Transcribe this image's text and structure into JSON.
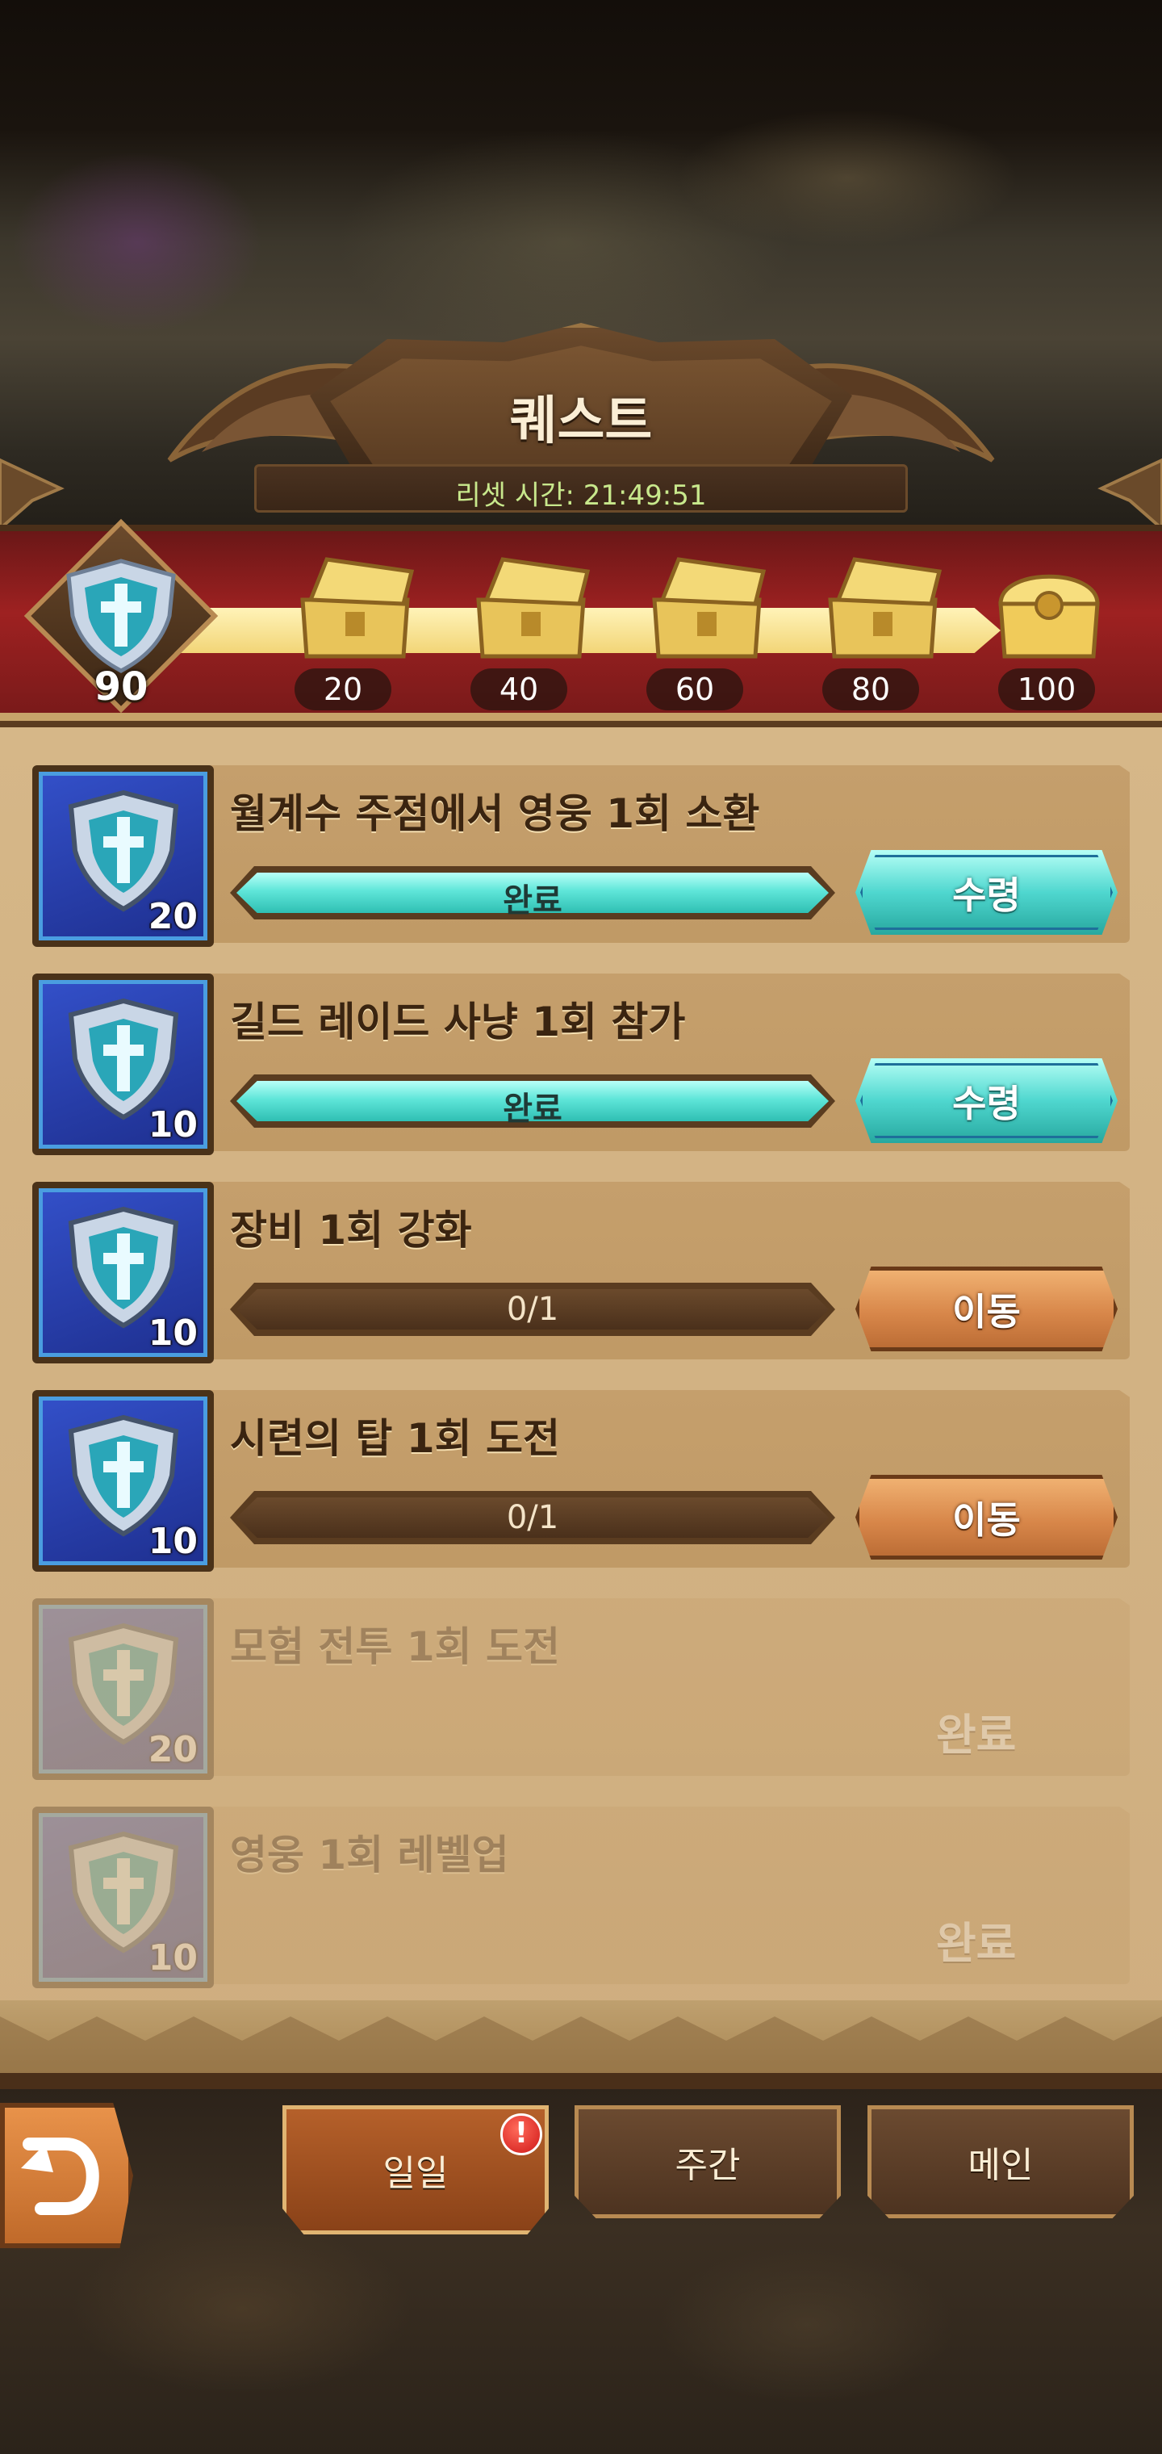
{
  "header": {
    "title": "퀘스트",
    "reset_label": "리셋 시간:",
    "reset_time": "21:49:51"
  },
  "progress": {
    "current_points": "90",
    "milestones": [
      "20",
      "40",
      "60",
      "80",
      "100"
    ]
  },
  "quests": [
    {
      "title": "월계수 주점에서 영웅 1회 소환",
      "reward": "20",
      "bar_text": "완료",
      "button": "수령"
    },
    {
      "title": "길드 레이드 사냥 1회 참가",
      "reward": "10",
      "bar_text": "완료",
      "button": "수령"
    },
    {
      "title": "장비 1회 강화",
      "reward": "10",
      "bar_text": "0/1",
      "button": "이동"
    },
    {
      "title": "시련의 탑 1회 도전",
      "reward": "10",
      "bar_text": "0/1",
      "button": "이동"
    },
    {
      "title": "모험 전투 1회 도전",
      "reward": "20",
      "status": "완료"
    },
    {
      "title": "영웅 1회 레벨업",
      "reward": "10",
      "status": "완료"
    }
  ],
  "tabs": {
    "daily": "일일",
    "weekly": "주간",
    "main": "메인",
    "alert_mark": "!"
  },
  "colors": {
    "panel": "#d3b384",
    "banner_red": "#9e2121",
    "claim_teal": "#4fd7cf",
    "go_orange": "#d8874a"
  }
}
